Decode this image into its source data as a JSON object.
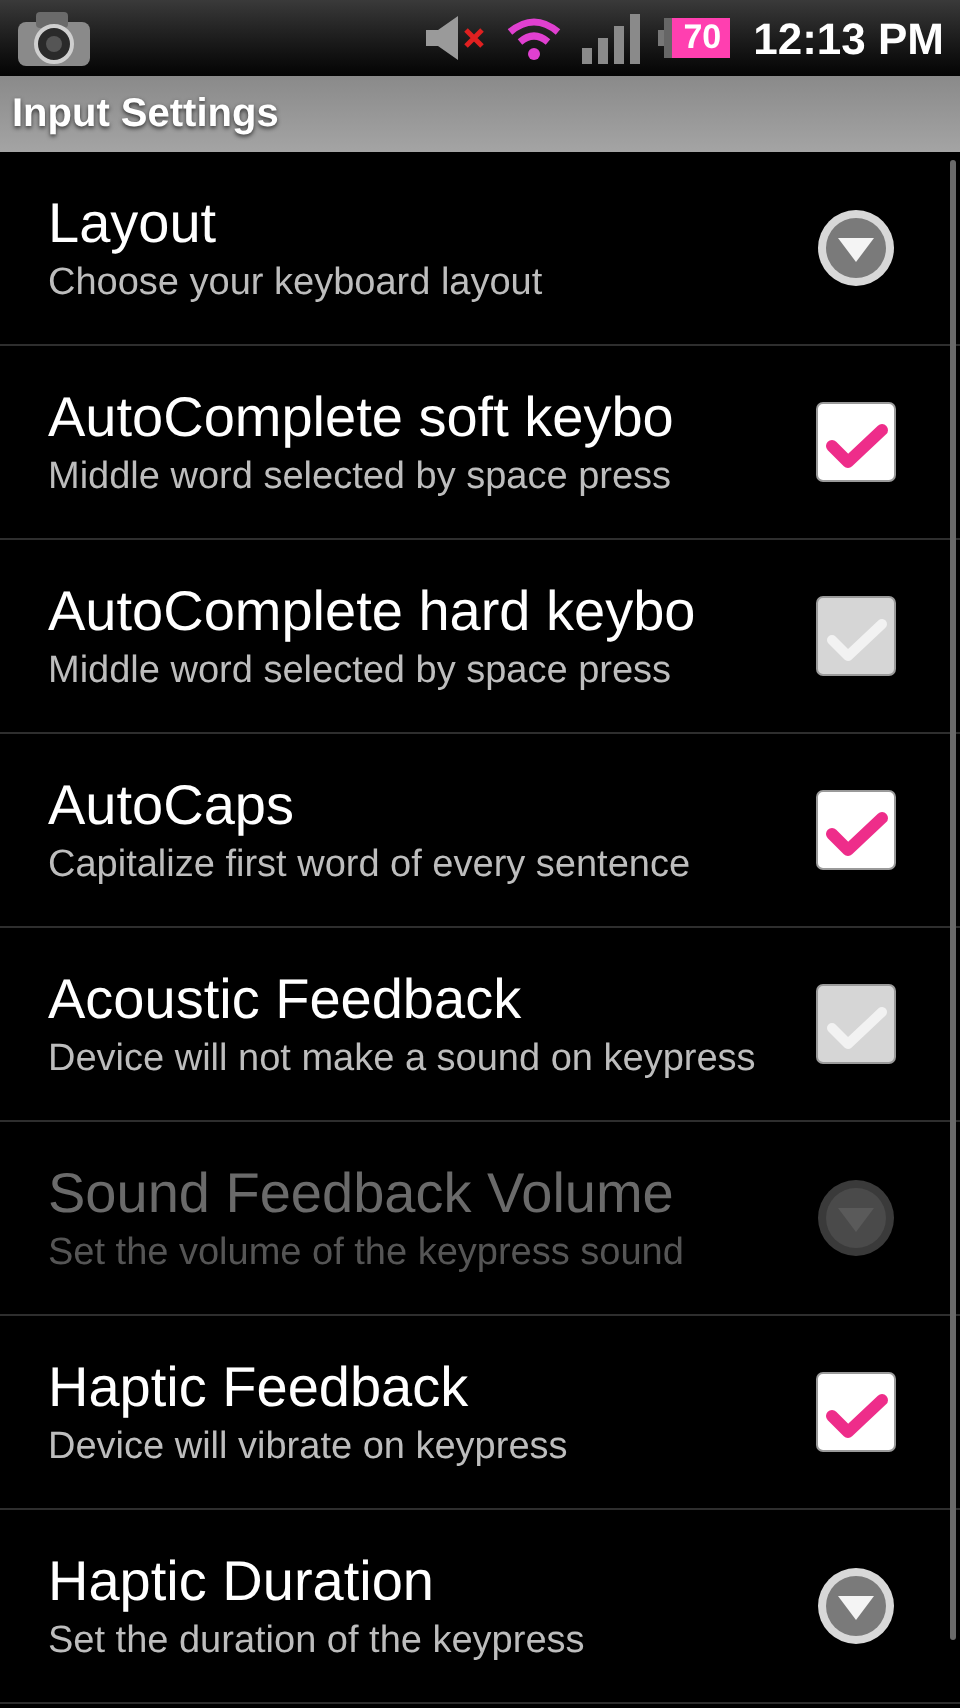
{
  "status_bar": {
    "battery": "70",
    "time": "12:13 PM"
  },
  "title_bar": {
    "title": "Input Settings"
  },
  "settings": [
    {
      "kind": "list",
      "title": "Layout",
      "summary": "Choose your keyboard layout",
      "disabled": false
    },
    {
      "kind": "checkbox",
      "title": "AutoComplete soft keybo",
      "summary": "Middle word selected by space press",
      "disabled": false,
      "checked": true
    },
    {
      "kind": "checkbox",
      "title": "AutoComplete hard keybo",
      "summary": "Middle word selected by space press",
      "disabled": false,
      "checked": false
    },
    {
      "kind": "checkbox",
      "title": "AutoCaps",
      "summary": "Capitalize first word of every sentence",
      "disabled": false,
      "checked": true
    },
    {
      "kind": "checkbox",
      "title": "Acoustic Feedback",
      "summary": "Device will not make a sound on keypress",
      "disabled": false,
      "checked": false
    },
    {
      "kind": "list",
      "title": "Sound Feedback Volume",
      "summary": "Set the volume of the keypress sound",
      "disabled": true
    },
    {
      "kind": "checkbox",
      "title": "Haptic Feedback",
      "summary": "Device will vibrate on keypress",
      "disabled": false,
      "checked": true
    },
    {
      "kind": "list",
      "title": "Haptic Duration",
      "summary": "Set the duration of the keypress",
      "disabled": false
    }
  ]
}
